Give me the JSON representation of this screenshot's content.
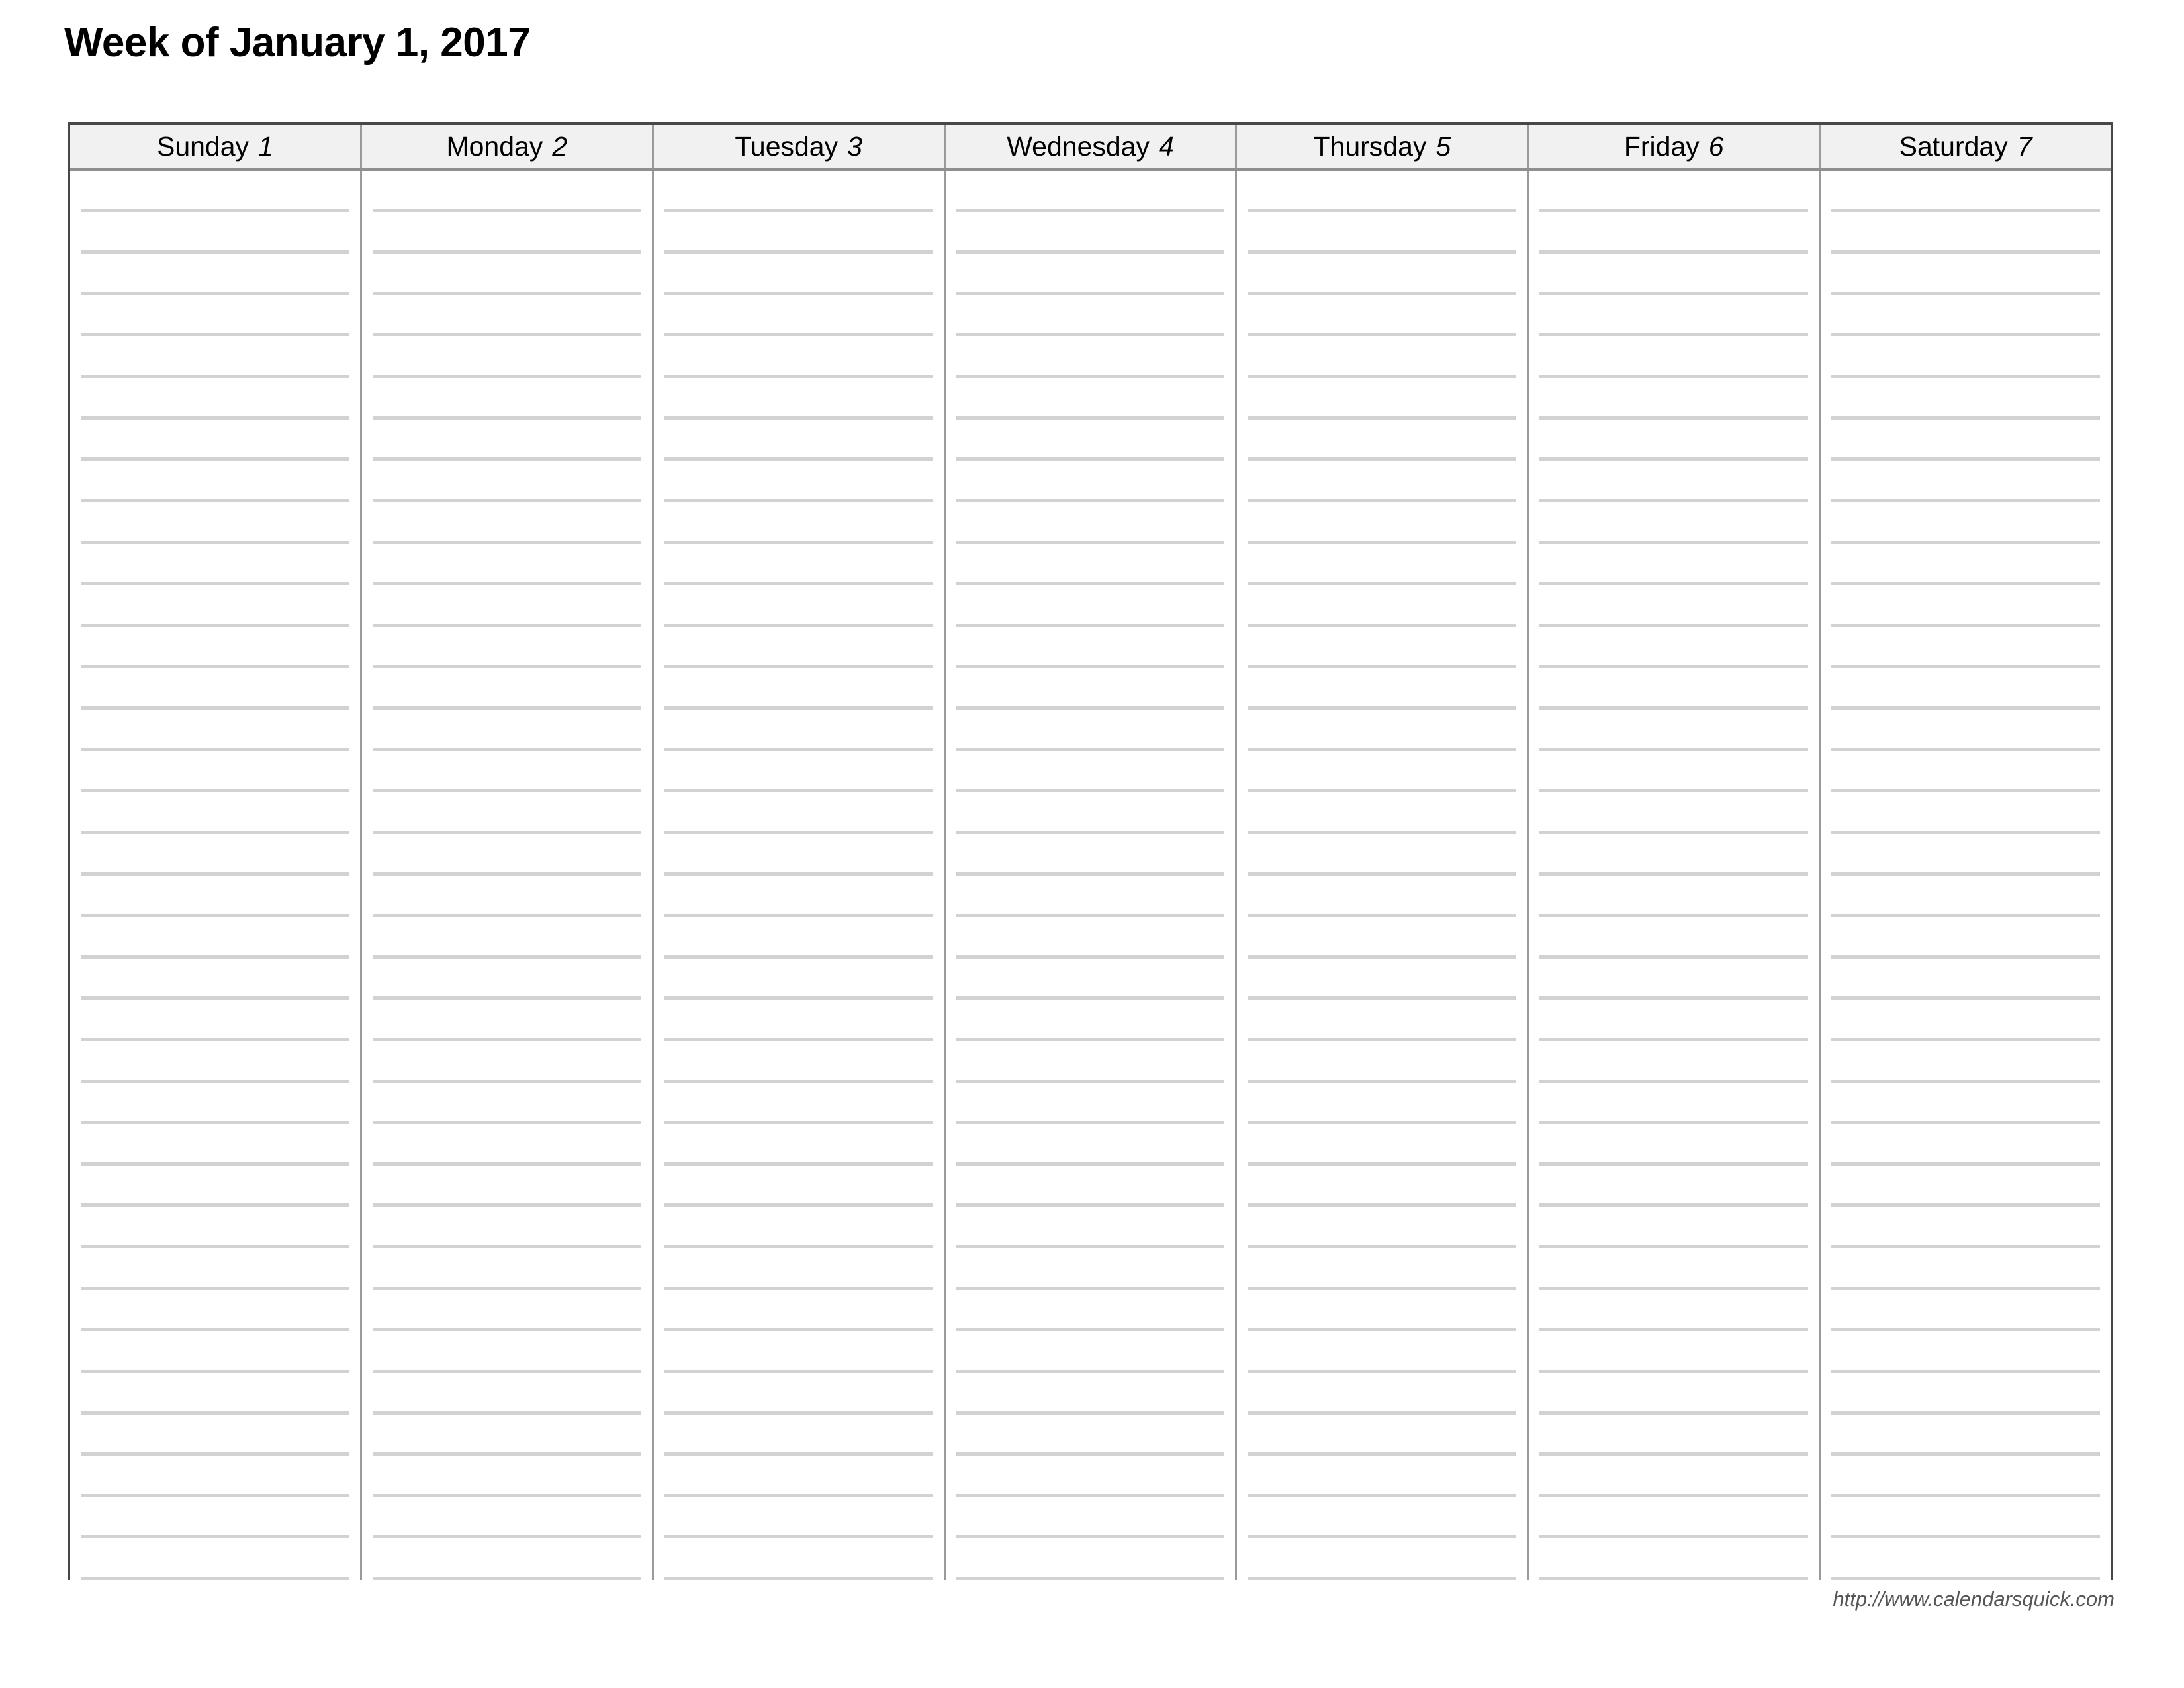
{
  "title": "Week of January 1, 2017",
  "calendar": {
    "week_start_date": "January 1, 2017",
    "columns": 7,
    "ruled_lines_per_column": 34,
    "days": [
      {
        "name": "Sunday",
        "date": "1"
      },
      {
        "name": "Monday",
        "date": "2"
      },
      {
        "name": "Tuesday",
        "date": "3"
      },
      {
        "name": "Wednesday",
        "date": "4"
      },
      {
        "name": "Thursday",
        "date": "5"
      },
      {
        "name": "Friday",
        "date": "6"
      },
      {
        "name": "Saturday",
        "date": "7"
      }
    ]
  },
  "footer": {
    "url": "http://www.calendarsquick.com"
  },
  "colors": {
    "page_background": "#ffffff",
    "title_text": "#000000",
    "grid_outer_border": "#474747",
    "grid_divider": "#9a9a9a",
    "header_background": "#f1f1f1",
    "header_text": "#000000",
    "rule_line": "#d2d2d2",
    "footer_text": "#555555"
  }
}
